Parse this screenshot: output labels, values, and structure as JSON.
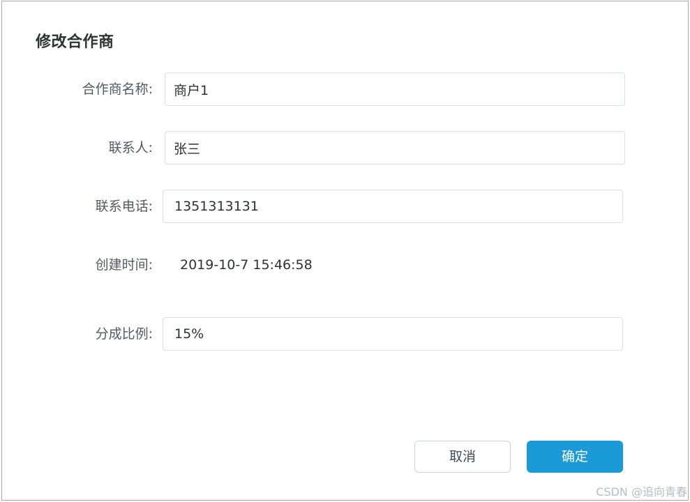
{
  "dialog": {
    "title": "修改合作商"
  },
  "form": {
    "partner_name": {
      "label": "合作商名称:",
      "value": "商户1"
    },
    "contact_person": {
      "label": "联系人:",
      "value": "张三"
    },
    "contact_phone": {
      "label": "联系电话:",
      "value": "1351313131"
    },
    "created_time": {
      "label": "创建时间:",
      "value": "2019-10-7 15:46:58"
    },
    "share_ratio": {
      "label": "分成比例:",
      "value": "15%"
    }
  },
  "footer": {
    "cancel_label": "取消",
    "confirm_label": "确定"
  },
  "watermark": "CSDN @追向青春",
  "colors": {
    "primary": "#1a9bd7",
    "border": "#dcdfe6",
    "text": "#303133"
  }
}
